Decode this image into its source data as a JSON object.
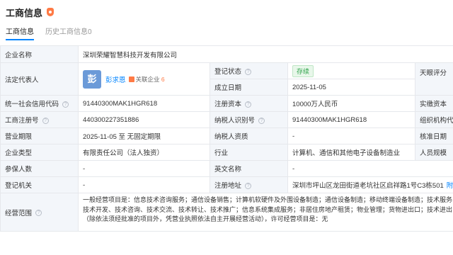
{
  "header": {
    "title": "工商信息"
  },
  "tabs": [
    {
      "label": "工商信息"
    },
    {
      "label": "历史工商信息0"
    }
  ],
  "company": {
    "name_label": "企业名称",
    "name": "深圳荣耀智慧科技开发有限公司",
    "rep_label": "法定代表人",
    "rep_avatar": "彭",
    "rep_name": "彭求恩",
    "rep_related_label": "关联企业",
    "rep_related_count": "6",
    "status_label": "登记状态",
    "status": "存续",
    "tianyan_label": "天眼评分",
    "est_date_label": "成立日期",
    "est_date": "2025-11-05",
    "credit_code_label": "统一社会信用代码",
    "credit_code": "91440300MAK1HGR618",
    "reg_capital_label": "注册资本",
    "reg_capital": "10000万人民币",
    "paid_capital_label": "实缴资本",
    "reg_no_label": "工商注册号",
    "reg_no": "440300227351886",
    "tax_id_label": "纳税人识别号",
    "tax_id": "91440300MAK1HGR618",
    "org_code_label": "组织机构代",
    "term_label": "营业期限",
    "term": "2025-11-05 至 无固定期限",
    "tax_qual_label": "纳税人资质",
    "tax_qual": "-",
    "approval_label": "核准日期",
    "type_label": "企业类型",
    "type": "有限责任公司（法人独资）",
    "industry_label": "行业",
    "industry": "计算机、通信和其他电子设备制造业",
    "staff_label": "人员规模",
    "insured_label": "参保人数",
    "insured": "-",
    "en_name_label": "英文名称",
    "en_name": "-",
    "authority_label": "登记机关",
    "authority": "-",
    "address_label": "注册地址",
    "address": "深圳市坪山区龙田街道老坑社区启祥路1号C3栋501",
    "address_link": "附",
    "scope_label": "经营范围",
    "scope": "一般经营项目是：信息技术咨询服务；通信设备销售；计算机软硬件及外围设备制造；通信设备制造；移动终端设备制造；技术服务、技术开发、技术咨询、技术交流、技术转让、技术推广；信息系统集成服务；非居住房地产租赁；物业管理；货物进出口；技术进出口（除依法须经批准的项目外，凭营业执照依法自主开展经营活动），许可经营项目是：无"
  }
}
